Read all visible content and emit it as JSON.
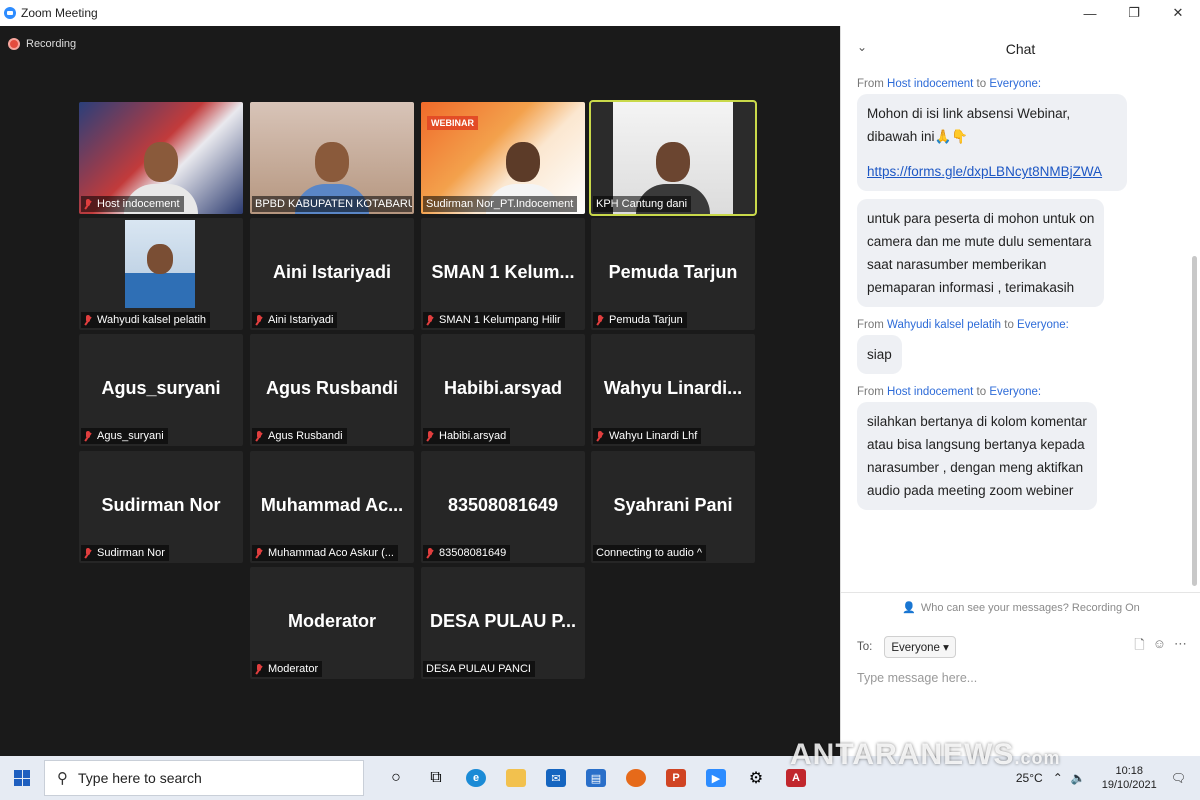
{
  "window": {
    "title": "Zoom Meeting",
    "minimize": "—",
    "maximize": "❐",
    "close": "✕"
  },
  "recording": "Recording",
  "tiles": [
    {
      "label": "Host indocement"
    },
    {
      "label": "BPBD KABUPATEN KOTABARU"
    },
    {
      "label": "Sudirman Nor_PT.Indocement",
      "badge": "WEBINAR"
    },
    {
      "label": "KPH Cantung dani"
    },
    {
      "label": "Wahyudi kalsel pelatih"
    },
    {
      "big": "Aini Istariyadi",
      "label": "Aini Istariyadi"
    },
    {
      "big": "SMAN 1 Kelum...",
      "label": "SMAN 1 Kelumpang Hilir"
    },
    {
      "big": "Pemuda Tarjun",
      "label": "Pemuda Tarjun"
    },
    {
      "big": "Agus_suryani",
      "label": "Agus_suryani"
    },
    {
      "big": "Agus Rusbandi",
      "label": "Agus Rusbandi"
    },
    {
      "big": "Habibi.arsyad",
      "label": "Habibi.arsyad"
    },
    {
      "big": "Wahyu  Linardi...",
      "label": "Wahyu Linardi Lhf"
    },
    {
      "big": "Sudirman Nor",
      "label": "Sudirman Nor"
    },
    {
      "big": "Muhammad  Ac...",
      "label": "Muhammad Aco Askur (..."
    },
    {
      "big": "83508081649",
      "label": "83508081649"
    },
    {
      "big": "Syahrani Pani",
      "label": "Connecting to audio ^"
    },
    {
      "big": "Moderator",
      "label": "Moderator"
    },
    {
      "big": "DESA PULAU P...",
      "label": "DESA PULAU PANCI"
    }
  ],
  "chat": {
    "title": "Chat",
    "from_word": "From",
    "to_word": "to",
    "everyone": "Everyone:",
    "messages": [
      {
        "sender": "Host indocement",
        "lines": [
          "Mohon di isi link absensi Webinar,",
          "dibawah ini🙏👇"
        ],
        "link": "https://forms.gle/dxpLBNcyt8NMBjZWA"
      },
      {
        "sender": "",
        "lines": [
          "untuk para peserta di mohon untuk on",
          "camera dan me mute dulu sementara",
          "saat narasumber memberikan",
          "pemaparan informasi , terimakasih"
        ]
      },
      {
        "sender": "Wahyudi kalsel pelatih",
        "lines": [
          "siap"
        ]
      },
      {
        "sender": "Host indocement",
        "lines": [
          "silahkan bertanya di kolom komentar",
          "atau bisa langsung bertanya kepada",
          "narasumber , dengan meng aktifkan",
          "audio pada meeting zoom webiner"
        ]
      }
    ],
    "visibility_note": "Who can see your messages? Recording On",
    "to_label": "To:",
    "to_value": "Everyone ▾",
    "placeholder": "Type message here..."
  },
  "taskbar": {
    "search_placeholder": "Type here to search",
    "weather": "25°C",
    "time": "10:18",
    "date": "19/10/2021"
  },
  "watermark": {
    "main": "ANTARANEWS",
    "suffix": ".com"
  }
}
